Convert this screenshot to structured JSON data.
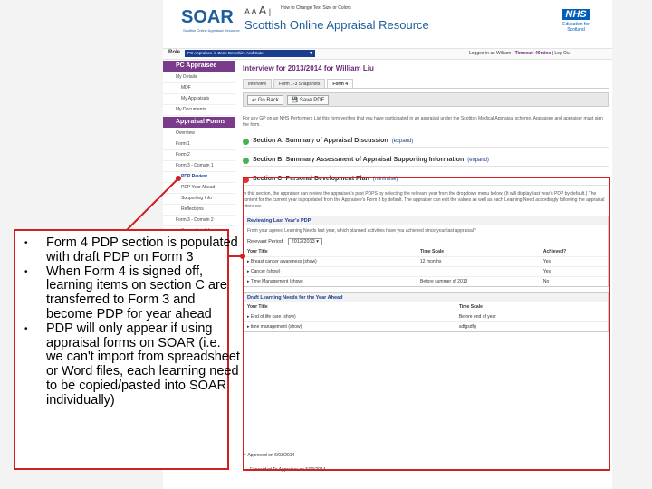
{
  "header": {
    "logo": "SOAR",
    "logo_sub": "Scottish Online Appraisal Resource",
    "text_size_small": "A",
    "text_size_medium": "A",
    "text_size_large": "A",
    "text_size_link": "How to Change Text Size or Colors",
    "site_title": "Scottish Online Appraisal Resource",
    "nhs_logo": "NHS",
    "nhs_sub": "Education for Scotland"
  },
  "rolebar": {
    "label": "Role",
    "selected_role": "PC Appraisee in Zone Berkshire And Cute",
    "logged_in": "Logged in as William",
    "timeout": "Timeout: 40mins",
    "log_out": "Log Out"
  },
  "sidebar": {
    "head1": "PC Appraisee",
    "items1": [
      "My Details",
      "MDF",
      "My Appraisals",
      "My Documents"
    ],
    "head2": "Appraisal Forms",
    "items2": [
      "Overview",
      "Form 1",
      "Form 2",
      "Form 3 - Domain 1",
      "PDP Review",
      "PDP Year Ahead",
      "Supporting Info",
      "Reflections",
      "Form 3 - Domain 2",
      "Supporting Info"
    ]
  },
  "main": {
    "title": "Interview for 2013/2014 for William Liu",
    "tabs": [
      "Interview",
      "Form 1-3 Snapshots",
      "Form 4"
    ],
    "go_back": "Go Back",
    "save_pdf": "Save PDF",
    "intro": "For any GP on an NHS Performers List this form verifies that you have participated in an appraisal under the Scottish Medical Appraisal scheme. Appraisee and appraiser must sign the form.",
    "section_a": "Section A: Summary of Appraisal Discussion",
    "section_b": "Section B: Summary Assessment of Appraisal Supporting Information",
    "section_c": "Section C: Personal Development Plan",
    "expand": "(expand)",
    "minimise": "(minimise)",
    "section_c_text": "In this section, the appraiser can review the appraisee's past PDPS by selecting the relevant year from the dropdown menu below. (It will display last year's PDP by default.)",
    "section_c_text2": "The content for the current year is populated from the Appraisee's Form 3 by default. The appraiser can edit the values as well as each Learning Need accordingly following the appraisal interview.",
    "review_head": "Reviewing Last Year's PDP",
    "review_text": "From your agreed Learning Needs last year, which planned activities have you achieved since your last appraisal?",
    "relevant_period_label": "Relevant Period",
    "relevant_period_value": "2012/2013",
    "review_cols": [
      "Your Title",
      "Time Scale",
      "Achieved?"
    ],
    "review_rows": [
      [
        "Breast cancer awareness (show)",
        "12 months",
        "Yes"
      ],
      [
        "Cancer (show)",
        "",
        "Yes"
      ],
      [
        "Time Management (show)",
        "Before summer of 2013",
        "No"
      ]
    ],
    "draft_head": "Draft Learning Needs for the Year Ahead",
    "draft_cols": [
      "Your Title",
      "Time Scale"
    ],
    "draft_rows": [
      [
        "End of life care (show)",
        "Before end of year"
      ],
      [
        "time management (show)",
        "sdfgsdfg"
      ]
    ],
    "approved": "Approved on 6/03/2014",
    "forwarded": "Forwarded To Appraiser on 5/03/2014"
  },
  "callout": {
    "bullets": [
      "Form 4 PDP section is populated with draft PDP on Form 3",
      "When Form 4 is signed off, learning items on section C are transferred to Form 3 and become PDP for year ahead",
      "PDP will only appear if using appraisal forms on SOAR (i.e. we can't import from spreadsheet or Word files, each learning need to be copied/pasted into SOAR individually)"
    ]
  },
  "colors": {
    "purple": "#7a3b8a",
    "blue": "#1d5d9b",
    "red_annotation": "#d21f1f"
  }
}
